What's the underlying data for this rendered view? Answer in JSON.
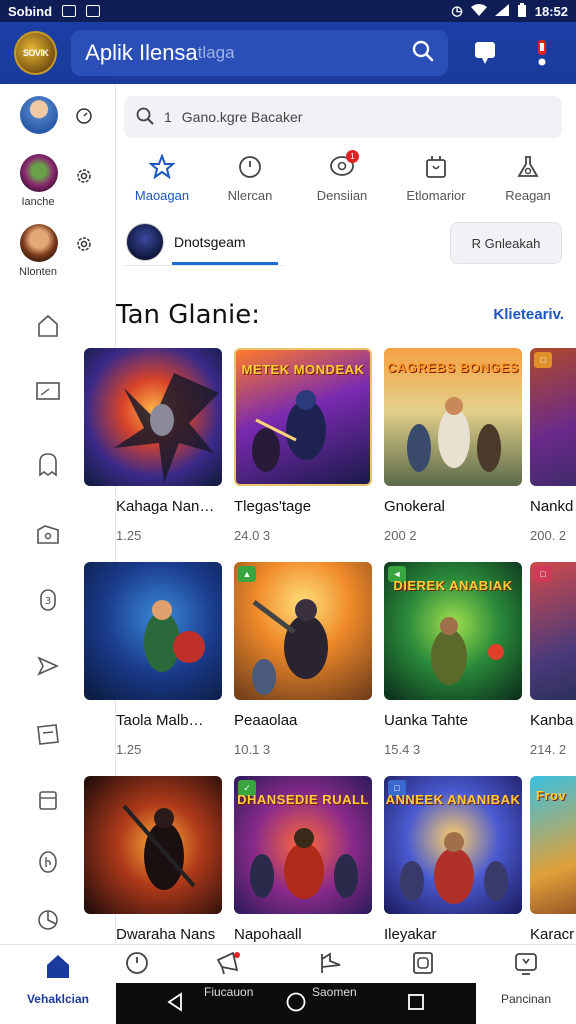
{
  "status_bar": {
    "left_text": "Sobind",
    "time": "18:52"
  },
  "app_bar": {
    "logo_text": "SOVIK",
    "title": "Aplik Ilensa",
    "title_suffix": "tlaga"
  },
  "rail": {
    "accounts": [
      {
        "label": ""
      },
      {
        "label": "Ianche"
      },
      {
        "label": "Nlonten"
      }
    ]
  },
  "search": {
    "placeholder": "Gano.kgre Bacaker",
    "prefix": "1"
  },
  "tabs": [
    {
      "label": "Maoagan",
      "icon": "star-icon",
      "active": true
    },
    {
      "label": "Nlercan",
      "icon": "clock-icon"
    },
    {
      "label": "Densiian",
      "icon": "chat-icon",
      "badge": "1"
    },
    {
      "label": "Etlomarior",
      "icon": "bag-icon"
    },
    {
      "label": "Reagan",
      "icon": "flask-icon"
    }
  ],
  "filter_chip": {
    "label": "Dnotsgeam"
  },
  "sort_button": {
    "label": "R Gnleakah"
  },
  "section": {
    "title": "Tan Glanie:",
    "more_label": "Klieteariv."
  },
  "games": [
    {
      "name": "Kahaga Nan…",
      "meta": "1.25",
      "title_art": ""
    },
    {
      "name": "Tlegas'tage",
      "meta": "24.0 3",
      "title_art": "METEK MONDEAK"
    },
    {
      "name": "Gnokeral",
      "meta": "200 2",
      "title_art": "CAGREBS BONGES"
    },
    {
      "name": "Nankd",
      "meta": "200. 2",
      "title_art": ""
    },
    {
      "name": "Taola Malb…",
      "meta": "1.25",
      "title_art": ""
    },
    {
      "name": "Peaaolaa",
      "meta": "10.1 3",
      "title_art": ""
    },
    {
      "name": "Uanka Tahte",
      "meta": "15.4 3",
      "title_art": "DIEREK ANABIAK"
    },
    {
      "name": "Kanba",
      "meta": "214. 2",
      "title_art": ""
    },
    {
      "name": "Dwaraha Nans",
      "meta": "",
      "title_art": ""
    },
    {
      "name": "Napohaall",
      "meta": "",
      "title_art": "DHANSEDIE RUALL"
    },
    {
      "name": "Ileyakar",
      "meta": "",
      "title_art": "ANNEEK ANANIBAK"
    },
    {
      "name": "Karacr",
      "meta": "",
      "title_art": "Frov"
    }
  ],
  "bottom_nav": {
    "home_label": "Vehaklcian",
    "items": [
      {
        "label": "",
        "icon": "clock-icon"
      },
      {
        "label": "Fiucauon",
        "icon": "megaphone-icon"
      },
      {
        "label": "Saomen",
        "icon": "flag-icon"
      },
      {
        "label": "",
        "icon": "tablet-icon"
      }
    ],
    "right_label": "Pancinan"
  },
  "colors": {
    "brand": "#1b3fa6",
    "accent": "#1a56c4",
    "status_bar": "#0f1d57"
  }
}
